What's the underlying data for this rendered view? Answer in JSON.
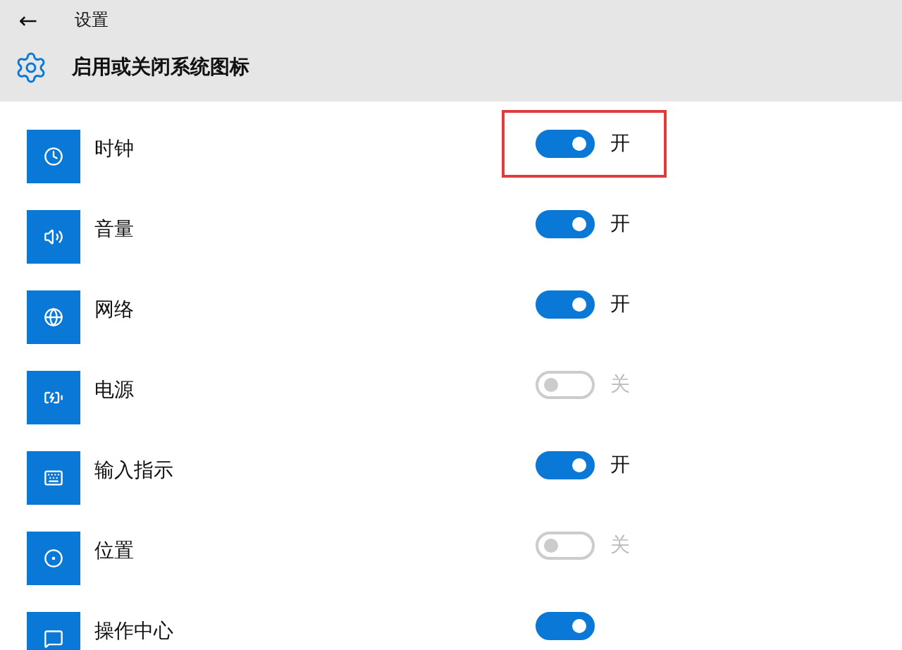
{
  "header": {
    "back": "←",
    "breadcrumb": "设置",
    "title": "启用或关闭系统图标"
  },
  "items": [
    {
      "kind": "clock",
      "name": "时钟",
      "on": true,
      "state_label": "开",
      "highlighted": true
    },
    {
      "kind": "volume",
      "name": "音量",
      "on": true,
      "state_label": "开",
      "highlighted": false
    },
    {
      "kind": "network",
      "name": "网络",
      "on": true,
      "state_label": "开",
      "highlighted": false
    },
    {
      "kind": "power",
      "name": "电源",
      "on": false,
      "state_label": "关",
      "highlighted": false
    },
    {
      "kind": "input",
      "name": "输入指示",
      "on": true,
      "state_label": "开",
      "highlighted": false
    },
    {
      "kind": "location",
      "name": "位置",
      "on": false,
      "state_label": "关",
      "highlighted": false
    },
    {
      "kind": "action",
      "name": "操作中心",
      "on": true,
      "highlighted": false
    }
  ]
}
